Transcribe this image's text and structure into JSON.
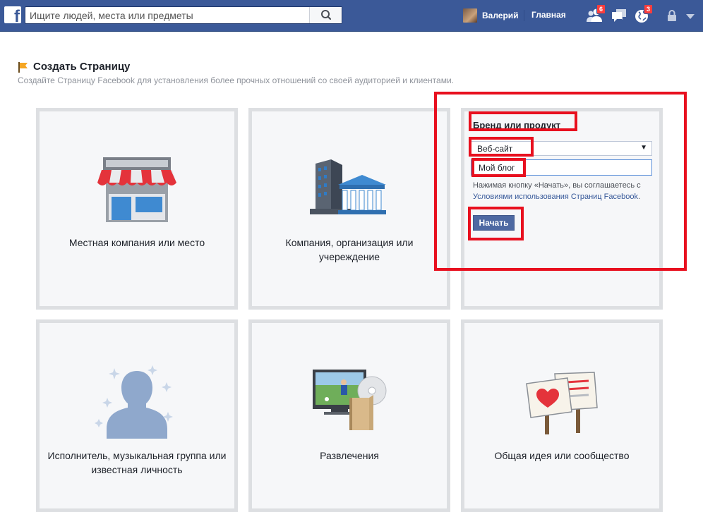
{
  "header": {
    "logo": "f",
    "search_placeholder": "Ищите людей, места или предметы",
    "user_name": "Валерий",
    "home_label": "Главная",
    "friend_requests_badge": "6",
    "notifications_badge": "3"
  },
  "page": {
    "title": "Создать Страницу",
    "subtitle": "Создайте Страницу Facebook для установления более прочных отношений со своей аудиторией и клиентами."
  },
  "categories": [
    {
      "label": "Местная компания или место"
    },
    {
      "label_line1": "Компания, организация или",
      "label_line2": "учереждение"
    },
    {
      "label_line1": "Исполнитель, музыкальная группа или",
      "label_line2": "известная личность"
    },
    {
      "label": "Развлечения"
    },
    {
      "label": "Общая идея или сообщество"
    }
  ],
  "brand_form": {
    "title": "Бренд или продукт",
    "category_value": "Веб-сайт",
    "name_value": "Мой блог",
    "note_prefix": "Нажимая кнопку «Начать», вы соглашаетесь с ",
    "note_link": "Условиями использования Страниц Facebook",
    "note_suffix": ".",
    "submit_label": "Начать"
  },
  "colors": {
    "brand_blue": "#3b5998",
    "annotation_red": "#e8101f",
    "badge_red": "#fa3e3e"
  }
}
